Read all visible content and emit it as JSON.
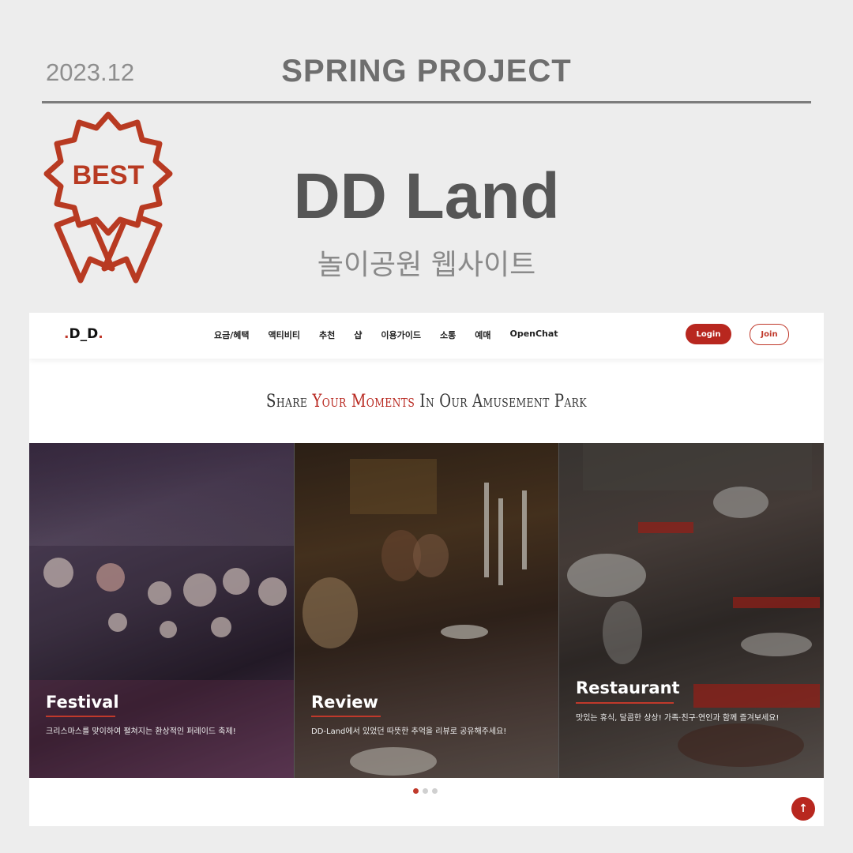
{
  "header": {
    "date": "2023.12",
    "project": "SPRING PROJECT"
  },
  "badge": {
    "label": "BEST",
    "color": "#b83a22"
  },
  "title": "DD Land",
  "subtitle": "놀이공원 웹사이트",
  "site": {
    "logo": ".D_D.",
    "menu": [
      "요금/혜택",
      "액티비티",
      "추천",
      "샵",
      "이용가이드",
      "소통",
      "예매",
      "OpenChat"
    ],
    "login_label": "Login",
    "join_label": "Join",
    "headline": {
      "part1": "Share ",
      "part2": "Your Moments",
      "part3": " In Our Amusement Park"
    },
    "panels": [
      {
        "title": "Festival",
        "text": "크리스마스를 맞이하여 펼쳐지는 환상적인 퍼레이드 축제!"
      },
      {
        "title": "Review",
        "text": "DD-Land에서 있었던 따뜻한 추억을 리뷰로 공유해주세요!"
      },
      {
        "title": "Restaurant",
        "text": "맛있는 휴식, 달콤한 상상! 가족·친구·연인과 함께 즐겨보세요!"
      }
    ],
    "pager": {
      "count": 3,
      "active": 1
    },
    "top_button_icon": "arrow-up-icon",
    "accent_color": "#b8271f"
  }
}
